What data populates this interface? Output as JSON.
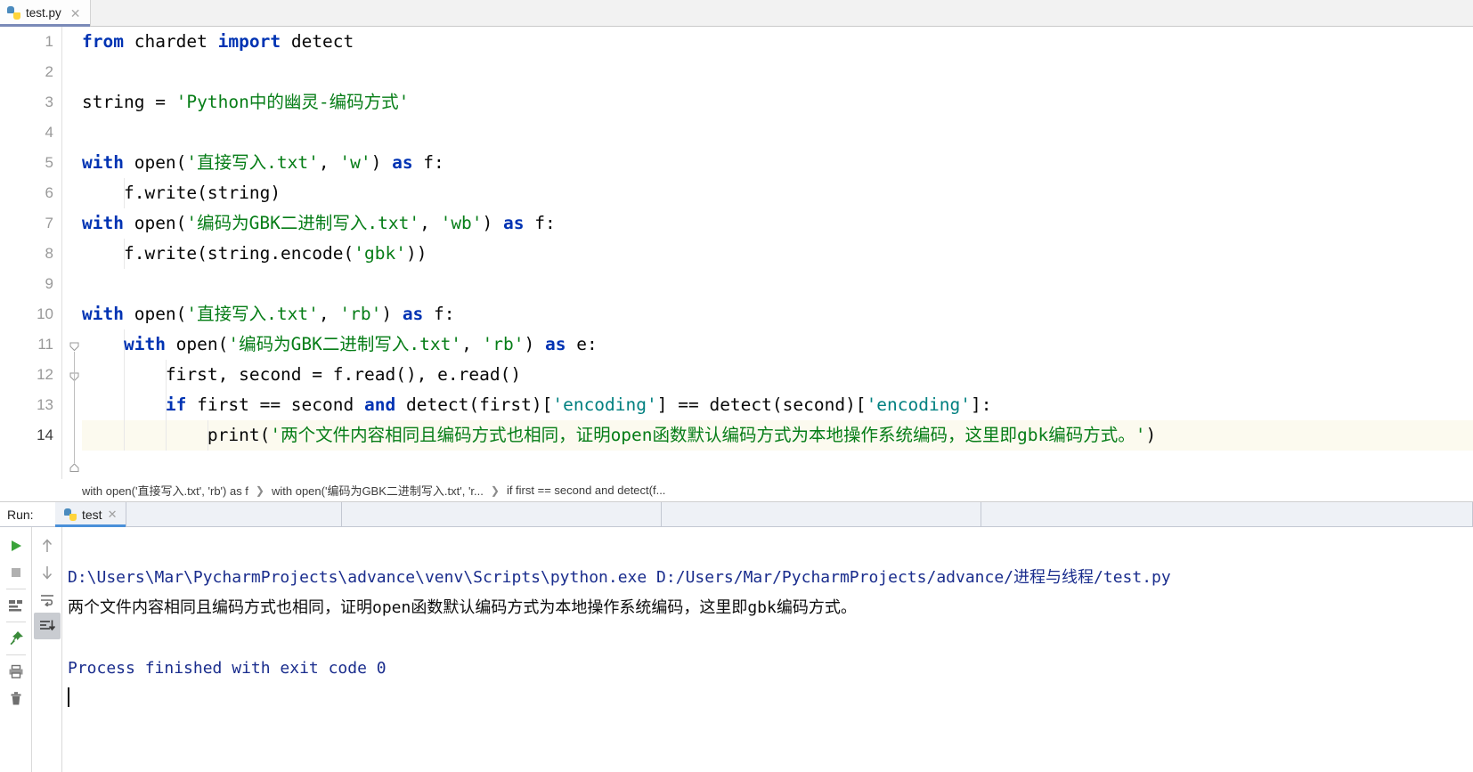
{
  "editor_tab": {
    "filename": "test.py",
    "icon": "python-file-icon",
    "close_icon": "close-icon"
  },
  "editor": {
    "lines": [
      {
        "n": "1",
        "indent": 0,
        "tokens": [
          {
            "t": "from",
            "c": "kw"
          },
          {
            "t": " chardet ",
            "c": "txt"
          },
          {
            "t": "import",
            "c": "kw"
          },
          {
            "t": " detect",
            "c": "txt"
          }
        ]
      },
      {
        "n": "2",
        "indent": 0,
        "tokens": []
      },
      {
        "n": "3",
        "indent": 0,
        "tokens": [
          {
            "t": "string ",
            "c": "txt"
          },
          {
            "t": "= ",
            "c": "txt"
          },
          {
            "t": "'Python中的幽灵-编码方式'",
            "c": "str"
          }
        ]
      },
      {
        "n": "4",
        "indent": 0,
        "tokens": []
      },
      {
        "n": "5",
        "indent": 0,
        "tokens": [
          {
            "t": "with",
            "c": "kw"
          },
          {
            "t": " open(",
            "c": "txt"
          },
          {
            "t": "'直接写入.txt'",
            "c": "str"
          },
          {
            "t": ", ",
            "c": "txt"
          },
          {
            "t": "'w'",
            "c": "str"
          },
          {
            "t": ") ",
            "c": "txt"
          },
          {
            "t": "as",
            "c": "kw"
          },
          {
            "t": " f:",
            "c": "txt"
          }
        ]
      },
      {
        "n": "6",
        "indent": 1,
        "tokens": [
          {
            "t": "    f.write(string)",
            "c": "txt"
          }
        ]
      },
      {
        "n": "7",
        "indent": 0,
        "tokens": [
          {
            "t": "with",
            "c": "kw"
          },
          {
            "t": " open(",
            "c": "txt"
          },
          {
            "t": "'编码为GBK二进制写入.txt'",
            "c": "str"
          },
          {
            "t": ", ",
            "c": "txt"
          },
          {
            "t": "'wb'",
            "c": "str"
          },
          {
            "t": ") ",
            "c": "txt"
          },
          {
            "t": "as",
            "c": "kw"
          },
          {
            "t": " f:",
            "c": "txt"
          }
        ]
      },
      {
        "n": "8",
        "indent": 1,
        "tokens": [
          {
            "t": "    f.write(string.encode(",
            "c": "txt"
          },
          {
            "t": "'gbk'",
            "c": "str"
          },
          {
            "t": "))",
            "c": "txt"
          }
        ]
      },
      {
        "n": "9",
        "indent": 0,
        "tokens": []
      },
      {
        "n": "10",
        "indent": 0,
        "tokens": [
          {
            "t": "with",
            "c": "kw"
          },
          {
            "t": " open(",
            "c": "txt"
          },
          {
            "t": "'直接写入.txt'",
            "c": "str"
          },
          {
            "t": ", ",
            "c": "txt"
          },
          {
            "t": "'rb'",
            "c": "str"
          },
          {
            "t": ") ",
            "c": "txt"
          },
          {
            "t": "as",
            "c": "kw"
          },
          {
            "t": " f:",
            "c": "txt"
          }
        ]
      },
      {
        "n": "11",
        "indent": 1,
        "tokens": [
          {
            "t": "    ",
            "c": "txt"
          },
          {
            "t": "with",
            "c": "kw"
          },
          {
            "t": " open(",
            "c": "txt"
          },
          {
            "t": "'编码为GBK二进制写入.txt'",
            "c": "str"
          },
          {
            "t": ", ",
            "c": "txt"
          },
          {
            "t": "'rb'",
            "c": "str"
          },
          {
            "t": ") ",
            "c": "txt"
          },
          {
            "t": "as",
            "c": "kw"
          },
          {
            "t": " e:",
            "c": "txt"
          }
        ]
      },
      {
        "n": "12",
        "indent": 2,
        "tokens": [
          {
            "t": "        first, second = f.read(), e.read()",
            "c": "txt"
          }
        ]
      },
      {
        "n": "13",
        "indent": 2,
        "tokens": [
          {
            "t": "        ",
            "c": "txt"
          },
          {
            "t": "if",
            "c": "kw"
          },
          {
            "t": " first == second ",
            "c": "txt"
          },
          {
            "t": "and",
            "c": "kw"
          },
          {
            "t": " detect(first)[",
            "c": "txt"
          },
          {
            "t": "'encoding'",
            "c": "dictkey"
          },
          {
            "t": "] == detect(second)[",
            "c": "txt"
          },
          {
            "t": "'encoding'",
            "c": "dictkey"
          },
          {
            "t": "]:",
            "c": "txt"
          }
        ]
      },
      {
        "n": "14",
        "indent": 3,
        "tokens": [
          {
            "t": "            print(",
            "c": "txt"
          },
          {
            "t": "'两个文件内容相同且编码方式也相同，证明open函数默认编码方式为本地操作系统编码，这里即gbk编码方式。'",
            "c": "str"
          },
          {
            "t": ")",
            "c": "txt"
          }
        ]
      }
    ],
    "current_line": "14",
    "fold_markers": [
      "line-10-fold",
      "line-11-fold",
      "line-14-fold"
    ]
  },
  "breadcrumb": {
    "items": [
      "with open('直接写入.txt', 'rb') as f",
      "with open('编码为GBK二进制写入.txt', 'r...",
      "if first == second and detect(f..."
    ],
    "separator": "❯"
  },
  "run_panel": {
    "label": "Run:",
    "tab": {
      "name": "test",
      "icon": "python-run-icon",
      "close_icon": "close-icon"
    },
    "toolbar_left": [
      {
        "name": "rerun-button",
        "icon": "play-icon"
      },
      {
        "name": "stop-button",
        "icon": "stop-icon"
      },
      {
        "name": "console-layout-button",
        "icon": "console-icon"
      },
      {
        "name": "pin-tab-button",
        "icon": "pin-icon"
      },
      {
        "name": "print-button",
        "icon": "printer-icon"
      },
      {
        "name": "clear-all-button",
        "icon": "trash-icon"
      }
    ],
    "toolbar_right": [
      {
        "name": "up-the-stack-button",
        "icon": "arrow-up-icon"
      },
      {
        "name": "down-the-stack-button",
        "icon": "arrow-down-icon"
      },
      {
        "name": "soft-wrap-button",
        "icon": "wrap-icon"
      },
      {
        "name": "scroll-to-end-button",
        "icon": "scroll-end-icon"
      }
    ],
    "console": {
      "command_line": "D:\\Users\\Mar\\PycharmProjects\\advance\\venv\\Scripts\\python.exe D:/Users/Mar/PycharmProjects/advance/进程与线程/test.py",
      "output_line": "两个文件内容相同且编码方式也相同，证明open函数默认编码方式为本地操作系统编码，这里即gbk编码方式。",
      "blank_line": "",
      "exit_line": "Process finished with exit code 0"
    }
  },
  "colors": {
    "keyword": "#0033b3",
    "string": "#067d17",
    "dict_key": "#008080",
    "console_path": "#1a2d8d",
    "tab_underline": "#7a8ab8",
    "run_tab_underline": "#4a90d9",
    "current_line_bg": "#fcfaef"
  }
}
